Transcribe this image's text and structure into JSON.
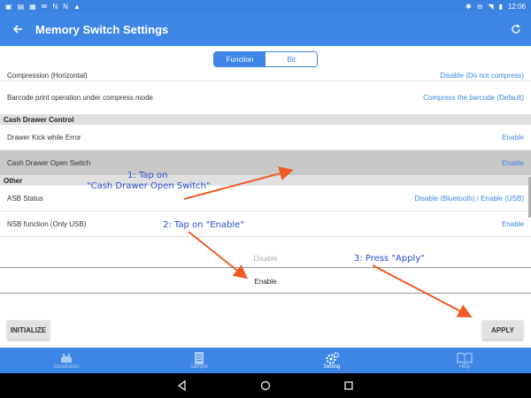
{
  "status_bar": {
    "time": "12:06"
  },
  "app_bar": {
    "title": "Memory Switch Settings"
  },
  "tabs": [
    {
      "label": "Function",
      "active": true
    },
    {
      "label": "Bit",
      "active": false
    }
  ],
  "rows_top": [
    {
      "label": "Compression (Horizontal)",
      "value": "Disable (Do not compress)"
    },
    {
      "label": "Barcode print operation under compress mode",
      "value": "Compress the barcode (Default)"
    }
  ],
  "section_cash": "Cash Drawer Control",
  "rows_cash": [
    {
      "label": "Drawer Kick while Error",
      "value": "Enable"
    },
    {
      "label": "Cash Drawer Open Switch",
      "value": "Enable"
    }
  ],
  "section_other": "Other",
  "rows_other": [
    {
      "label": "ASB Status",
      "value": "Disable (Bluetooth) / Enable (USB)"
    },
    {
      "label": "NSB function (Only USB)",
      "value": "Enable"
    }
  ],
  "picker": {
    "option_disable": "Disable",
    "option_enable": "Enable"
  },
  "buttons": {
    "initialize": "INITIALIZE",
    "apply": "APPLY"
  },
  "bottom_nav": [
    {
      "label": "Installation",
      "icon": "printer-icon",
      "active": false
    },
    {
      "label": "Sample",
      "icon": "receipt-icon",
      "active": false
    },
    {
      "label": "Setting",
      "icon": "gear-icon",
      "active": true
    },
    {
      "label": "Help",
      "icon": "book-icon",
      "active": false
    }
  ],
  "annotations": {
    "step1_line1": "1: Tap on",
    "step1_line2": "\"Cash Drawer Open Switch\"",
    "step2": "2: Tap on \"Enable\"",
    "step3": "3: Press \"Apply\""
  },
  "colors": {
    "accent": "#3d86e5",
    "selected_row": "#c8c8c8",
    "section_bg": "#e0e0e0",
    "arrow": "#f05a24",
    "annotation_text": "#2b4ccf"
  }
}
